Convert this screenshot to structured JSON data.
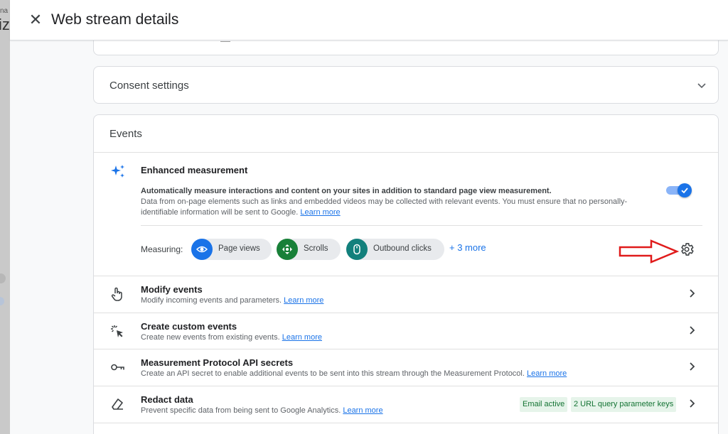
{
  "backdrop": {
    "fragment_top": "na",
    "fragment_big": "iz"
  },
  "header": {
    "title": "Web stream details",
    "close_icon": "close-icon"
  },
  "consent": {
    "label": "Consent settings",
    "icon": "chevron-down-icon"
  },
  "events": {
    "title": "Events",
    "enhanced": {
      "title": "Enhanced measurement",
      "bold_desc": "Automatically measure interactions and content on your sites in addition to standard page view measurement.",
      "desc": "Data from on-page elements such as links and embedded videos may be collected with relevant events. You must ensure that no personally-identifiable information will be sent to Google.",
      "learn_more": "Learn more",
      "toggle_on": true,
      "measuring_label": "Measuring:",
      "chips": [
        {
          "label": "Page views",
          "icon": "eye-icon",
          "color": "#1a73e8"
        },
        {
          "label": "Scrolls",
          "icon": "scroll-icon",
          "color": "#188038"
        },
        {
          "label": "Outbound clicks",
          "icon": "mouse-icon",
          "color": "#12807c"
        }
      ],
      "more": "+ 3 more",
      "annotation_color": "#e01b1b"
    },
    "rows": [
      {
        "title": "Modify events",
        "desc": "Modify incoming events and parameters.",
        "link": "Learn more",
        "icon": "touch-hand-icon"
      },
      {
        "title": "Create custom events",
        "desc": "Create new events from existing events.",
        "link": "Learn more",
        "icon": "sparkle-click-icon"
      },
      {
        "title": "Measurement Protocol API secrets",
        "desc": "Create an API secret to enable additional events to be sent into this stream through the Measurement Protocol.",
        "link": "Learn more",
        "icon": "key-icon"
      },
      {
        "title": "Redact data",
        "desc": "Prevent specific data from being sent to Google Analytics.",
        "link": "Learn more",
        "icon": "eraser-icon",
        "badges": [
          "Email active",
          "2 URL query parameter keys"
        ]
      }
    ]
  }
}
